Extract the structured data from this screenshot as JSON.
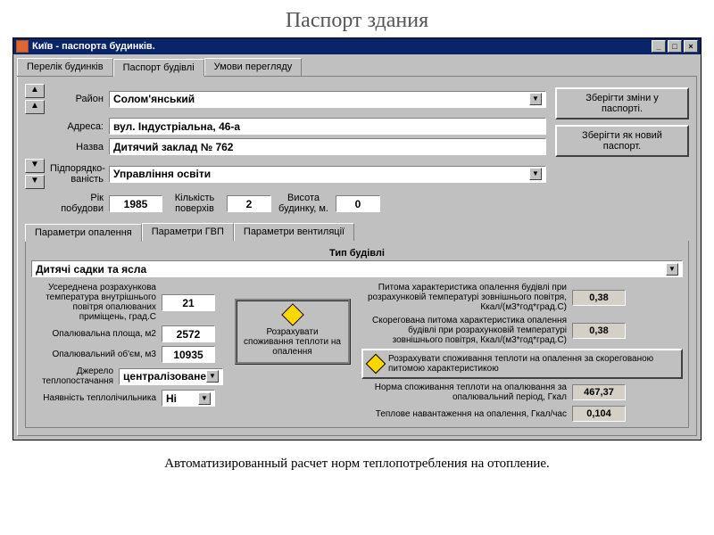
{
  "page_title": "Паспорт здания",
  "footer": "Автоматизированный расчет норм теплопотребления на отопление.",
  "window": {
    "title": "Київ - паспорта будинків.",
    "tabs": [
      "Перелік будинків",
      "Паспорт будівлі",
      "Умови перегляду"
    ],
    "active_tab": 1,
    "buttons": {
      "save": "Зберігти зміни у паспорті.",
      "save_as": "Зберігти як новий паспорт."
    },
    "fields": {
      "district_label": "Район",
      "district": "Солом'янський",
      "address_label": "Адреса:",
      "address": "вул. Індустріальна, 46-а",
      "name_label": "Назва",
      "name": "Дитячий заклад № 762",
      "subordination_label": "Підпорядко-\nваність",
      "subordination": "Управління освіти",
      "year_label": "Рік побудови",
      "year": "1985",
      "floors_label": "Кількість\nповерхів",
      "floors": "2",
      "height_label": "Висота\nбудинку, м.",
      "height": "0"
    },
    "subtabs": [
      "Параметри опалення",
      "Параметри ГВП",
      "Параметри вентиляції"
    ],
    "building_type_label": "Тип будівлі",
    "building_type": "Дитячі садки та ясла",
    "heating": {
      "avg_temp_label": "Усереднена розрахункова температура внутрішнього повітря опалюваних приміщень, град.С",
      "avg_temp": "21",
      "area_label": "Опалювальна площа, м2",
      "area": "2572",
      "volume_label": "Опалювальний об'єм, м3",
      "volume": "10935",
      "source_label": "Джерело теплопостачання",
      "source": "централізоване",
      "meter_label": "Наявність теплолічильника",
      "meter": "Ні",
      "calc_btn": "Розрахувати споживання теплоти на опалення",
      "specific_label": "Питома характеристика опалення будівлі при розрахунковій температурі зовнішнього повітря, Ккал/(м3*год*град.С)",
      "specific": "0,38",
      "corrected_label": "Скорегована питома характеристика опалення будівлі при розрахунковій температурі зовнішнього повітря, Ккал/(м3*год*град.С)",
      "corrected": "0,38",
      "recalc_btn": "Розрахувати споживання теплоти на опалення за скорегованою питомою характеристикою",
      "norm_label": "Норма споживання теплоти на опалювання за опалювальний період, Гкал",
      "norm": "467,37",
      "load_label": "Теплове навантаження на опалення, Гкал/час",
      "load": "0,104"
    }
  }
}
